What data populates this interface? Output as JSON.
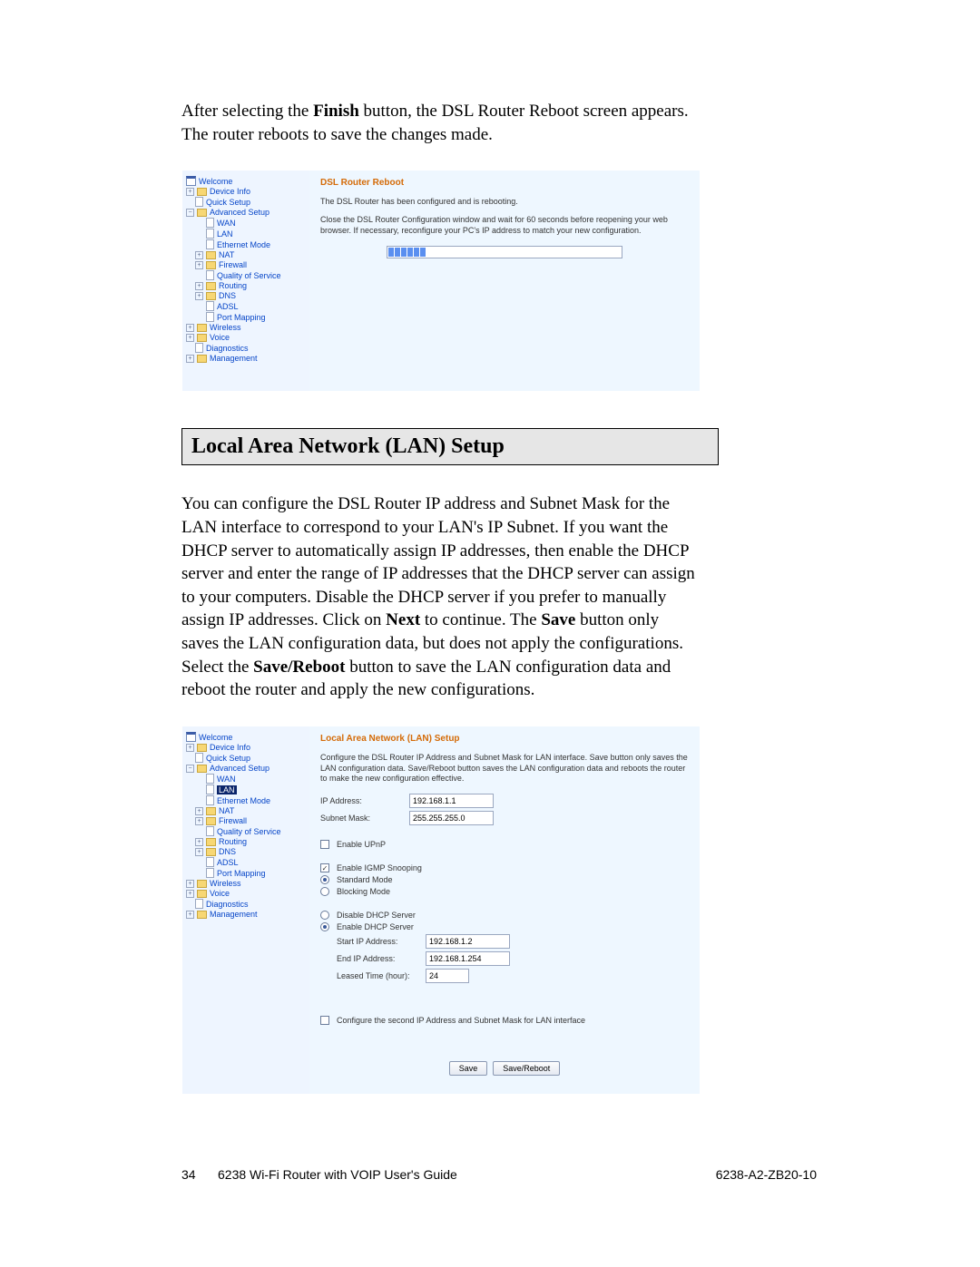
{
  "para1_pre": "After selecting the ",
  "para1_b1": "Finish",
  "para1_post": " button, the DSL Router Reboot screen appears. The router reboots to save the changes made.",
  "nav1": {
    "welcome": "Welcome",
    "device_info": "Device Info",
    "quick_setup": "Quick Setup",
    "advanced_setup": "Advanced Setup",
    "wan": "WAN",
    "lan": "LAN",
    "ethernet_mode": "Ethernet Mode",
    "nat": "NAT",
    "firewall": "Firewall",
    "qos": "Quality of Service",
    "routing": "Routing",
    "dns": "DNS",
    "adsl": "ADSL",
    "port_mapping": "Port Mapping",
    "wireless": "Wireless",
    "voice": "Voice",
    "diagnostics": "Diagnostics",
    "management": "Management"
  },
  "reboot": {
    "title": "DSL Router Reboot",
    "msg1": "The DSL Router has been configured and is rebooting.",
    "msg2": "Close the DSL Router Configuration window and wait for 60 seconds before reopening your web browser. If necessary, reconfigure your PC's IP address to match your new configuration."
  },
  "section_heading": "Local Area Network (LAN) Setup",
  "para2_a": "You can configure the DSL Router IP address and Subnet Mask for the LAN interface to correspond to your LAN's IP Subnet. If you want the DHCP server to automatically assign IP addresses, then enable the DHCP server and enter the range of IP addresses that the DHCP server can assign to your computers. Disable the DHCP server if you prefer to manually assign IP addresses. Click on ",
  "para2_b_next": "Next",
  "para2_b": " to continue. The ",
  "para2_b_save": "Save",
  "para2_c": " button only saves the LAN configuration data, but does not apply the configurations. Select the ",
  "para2_b_sr": "Save/Reboot",
  "para2_d": " button to save the LAN configuration data and reboot the router and apply the new configurations.",
  "lan": {
    "title": "Local Area Network (LAN) Setup",
    "desc": "Configure the DSL Router IP Address and Subnet Mask for LAN interface.  Save button only saves the LAN configuration data. Save/Reboot button saves the LAN configuration data and reboots the router to make the new configuration effective.",
    "ip_label": "IP Address:",
    "ip_value": "192.168.1.1",
    "mask_label": "Subnet Mask:",
    "mask_value": "255.255.255.0",
    "upnp": "Enable UPnP",
    "igmp": "Enable IGMP Snooping",
    "std_mode": "Standard Mode",
    "blk_mode": "Blocking Mode",
    "dhcp_disable": "Disable DHCP Server",
    "dhcp_enable": "Enable DHCP Server",
    "start_ip_label": "Start IP Address:",
    "start_ip_value": "192.168.1.2",
    "end_ip_label": "End IP Address:",
    "end_ip_value": "192.168.1.254",
    "lease_label": "Leased Time (hour):",
    "lease_value": "24",
    "second_ip": "Configure the second IP Address and Subnet Mask for LAN interface",
    "save_btn": "Save",
    "save_reboot_btn": "Save/Reboot"
  },
  "footer": {
    "page": "34",
    "title": "6238 Wi-Fi Router with VOIP User's Guide",
    "doc": "6238-A2-ZB20-10"
  }
}
